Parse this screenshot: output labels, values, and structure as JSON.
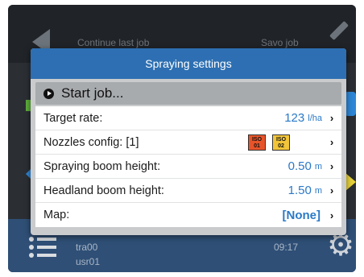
{
  "background": {
    "left_title": "Continue last job",
    "right_title": "Savo job",
    "bottom_line_1": "tra00",
    "bottom_line_2": "usr01",
    "time": "09:17"
  },
  "dialog": {
    "title": "Spraying settings",
    "start_label": "Start job...",
    "rows": [
      {
        "label": "Target rate:",
        "value": "123",
        "unit": "l/ha"
      },
      {
        "label": "Nozzles config: [1]",
        "badges": [
          "ISO\n01",
          "ISO\n02"
        ]
      },
      {
        "label": "Spraying boom height:",
        "value": "0.50",
        "unit": "m"
      },
      {
        "label": "Headland boom height:",
        "value": "1.50",
        "unit": "m"
      },
      {
        "label": "Map:",
        "value": "[None]"
      }
    ]
  },
  "colors": {
    "header_blue": "#2d6fb2",
    "value_blue": "#2b79c7",
    "iso_red": "#e8542a",
    "iso_yellow": "#f2c53a"
  },
  "icons": {
    "back": "back-arrow-icon",
    "edit": "pencil-icon",
    "menu": "list-icon",
    "settings": "gear-icon",
    "play": "play-circle-icon",
    "chevron": "chevron-right-icon"
  }
}
